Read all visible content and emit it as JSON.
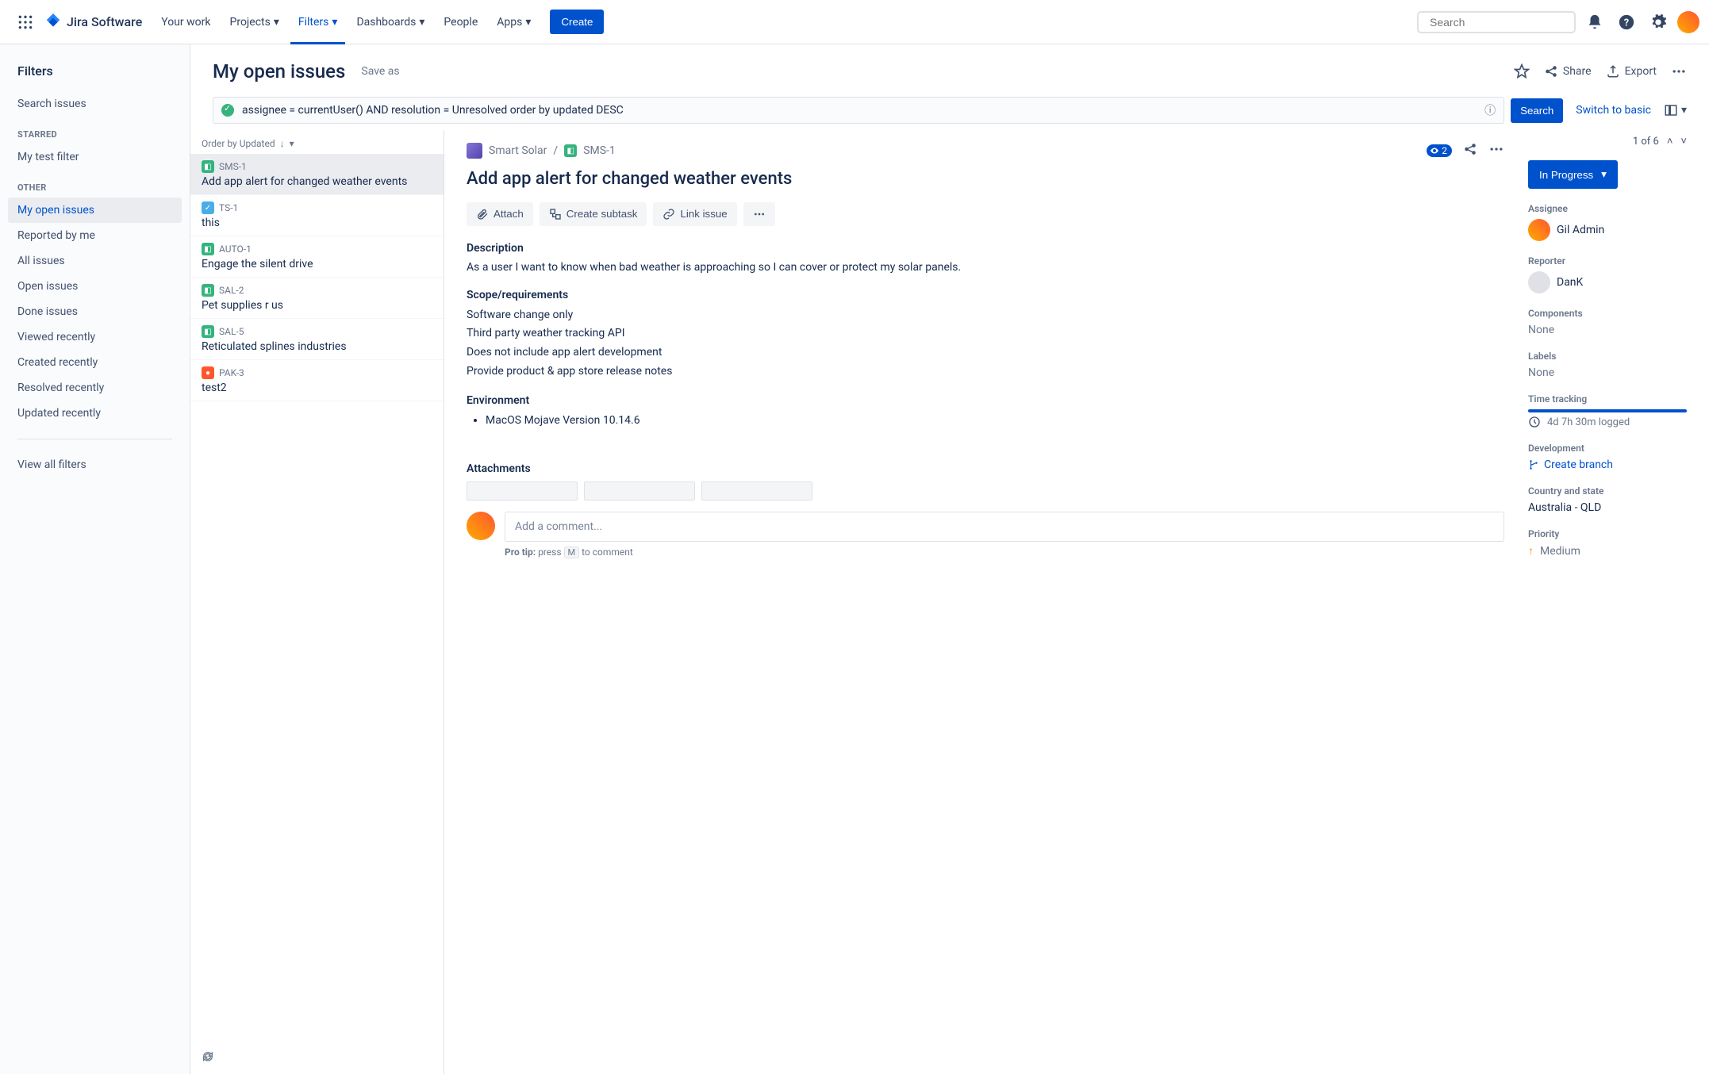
{
  "topnav": {
    "product": "Jira Software",
    "items": [
      "Your work",
      "Projects",
      "Filters",
      "Dashboards",
      "People",
      "Apps"
    ],
    "active_index": 2,
    "create_label": "Create",
    "search_placeholder": "Search"
  },
  "sidebar": {
    "title": "Filters",
    "search_issues": "Search issues",
    "starred_label": "STARRED",
    "starred": [
      "My test filter"
    ],
    "other_label": "OTHER",
    "other": [
      "My open issues",
      "Reported by me",
      "All issues",
      "Open issues",
      "Done issues",
      "Viewed recently",
      "Created recently",
      "Resolved recently",
      "Updated recently"
    ],
    "active_other_index": 0,
    "view_all": "View all filters"
  },
  "page": {
    "title": "My open issues",
    "save_as": "Save as",
    "share": "Share",
    "export": "Export",
    "jql": "assignee = currentUser() AND resolution = Unresolved order by updated DESC",
    "search_btn": "Search",
    "switch_basic": "Switch to basic"
  },
  "list": {
    "order_label": "Order by Updated",
    "issues": [
      {
        "key": "SMS-1",
        "type": "story",
        "summary": "Add app alert for changed weather events"
      },
      {
        "key": "TS-1",
        "type": "task",
        "summary": "this"
      },
      {
        "key": "AUTO-1",
        "type": "story",
        "summary": "Engage the silent drive"
      },
      {
        "key": "SAL-2",
        "type": "story",
        "summary": "Pet supplies r us"
      },
      {
        "key": "SAL-5",
        "type": "story",
        "summary": "Reticulated splines industries"
      },
      {
        "key": "PAK-3",
        "type": "bug",
        "summary": "test2"
      }
    ],
    "selected_index": 0
  },
  "pager": "1 of 6",
  "detail": {
    "project": "Smart Solar",
    "key": "SMS-1",
    "watchers": "2",
    "title": "Add app alert for changed weather events",
    "actions": {
      "attach": "Attach",
      "subtask": "Create subtask",
      "link": "Link issue"
    },
    "description_heading": "Description",
    "description": "As a user I want to know when bad weather is approaching so I can cover or protect my solar panels.",
    "scope_heading": "Scope/requirements",
    "scope": [
      "Software change only",
      "Third party weather tracking API",
      "Does not include app alert development",
      "Provide product & app store release notes"
    ],
    "env_heading": "Environment",
    "environment": [
      "MacOS Mojave Version 10.14.6"
    ],
    "attachments_heading": "Attachments",
    "comment_placeholder": "Add a comment...",
    "pro_tip_prefix": "Pro tip:",
    "pro_tip_press": "press",
    "pro_tip_key": "M",
    "pro_tip_suffix": "to comment"
  },
  "side": {
    "status": "In Progress",
    "assignee_label": "Assignee",
    "assignee": "Gil Admin",
    "reporter_label": "Reporter",
    "reporter": "DanK",
    "components_label": "Components",
    "components": "None",
    "labels_label": "Labels",
    "labels": "None",
    "time_label": "Time tracking",
    "time_value": "4d 7h 30m logged",
    "dev_label": "Development",
    "create_branch": "Create branch",
    "country_label": "Country and state",
    "country": "Australia - QLD",
    "priority_label": "Priority",
    "priority": "Medium"
  }
}
